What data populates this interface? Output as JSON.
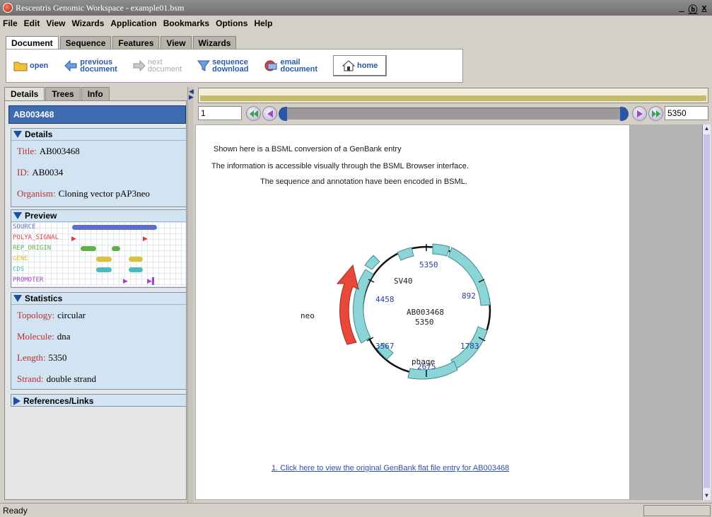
{
  "window": {
    "title": "Rescentris Genomic Workspace - example01.bsm",
    "controls": [
      "_",
      "ⓑ",
      "x"
    ]
  },
  "menu": [
    "File",
    "Edit",
    "View",
    "Wizards",
    "Application",
    "Bookmarks",
    "Options",
    "Help"
  ],
  "toolbar_tabs": [
    "Document",
    "Sequence",
    "Features",
    "View",
    "Wizards"
  ],
  "toolbar": {
    "open": "open",
    "previous": [
      "previous",
      "document"
    ],
    "next": [
      "next",
      "document"
    ],
    "sequence_download": [
      "sequence",
      "download"
    ],
    "email": [
      "email",
      "document"
    ],
    "home": "home"
  },
  "left_tabs": [
    "Details",
    "Trees",
    "Info"
  ],
  "accession": "AB003468",
  "details": {
    "heading": "Details",
    "title_label": "Title:",
    "title_value": "AB003468",
    "id_label": "ID:",
    "id_value": "AB0034",
    "organism_label": "Organism:",
    "organism_value": "Cloning vector pAP3neo"
  },
  "preview": {
    "heading": "Preview",
    "rows": [
      "SOURCE",
      "POLYA_SIGNAL",
      "REP_ORIGIN",
      "GENE",
      "CDS",
      "PROMOTER"
    ],
    "colors": {
      "SOURCE": "#5b6fd0",
      "POLYA_SIGNAL": "#d84040",
      "REP_ORIGIN": "#62b04a",
      "GENE": "#d9c23a",
      "CDS": "#4fb8c2",
      "PROMOTER": "#a048c0"
    }
  },
  "statistics": {
    "heading": "Statistics",
    "topology_label": "Topology:",
    "topology_value": "circular",
    "molecule_label": "Molecule:",
    "molecule_value": "dna",
    "length_label": "Length:",
    "length_value": "5350",
    "strand_label": "Strand:",
    "strand_value": "double strand"
  },
  "references": {
    "heading": "References/Links"
  },
  "nav": {
    "start": "1",
    "end": "5350"
  },
  "content": {
    "line1": "Shown here is a BSML conversion of a GenBank entry",
    "line2": "The information is accessible visually through the BSML Browser interface.",
    "line3": "The sequence and annotation have been encoded in BSML.",
    "link": "1. Click here to view the original GenBank flat file entry for AB003468"
  },
  "plasmid": {
    "name": "AB003468",
    "length": "5350",
    "ticks": [
      "5350",
      "892",
      "1783",
      "2675",
      "3567",
      "4458"
    ],
    "labels": {
      "sv40": "SV40",
      "phage": "phage",
      "neo": "neo"
    },
    "colors": {
      "feature": "#8dd4d6",
      "feature_stroke": "#3a8f95",
      "neo": "#e8483a",
      "tick_text": "#2a3f9e"
    }
  },
  "status": "Ready"
}
